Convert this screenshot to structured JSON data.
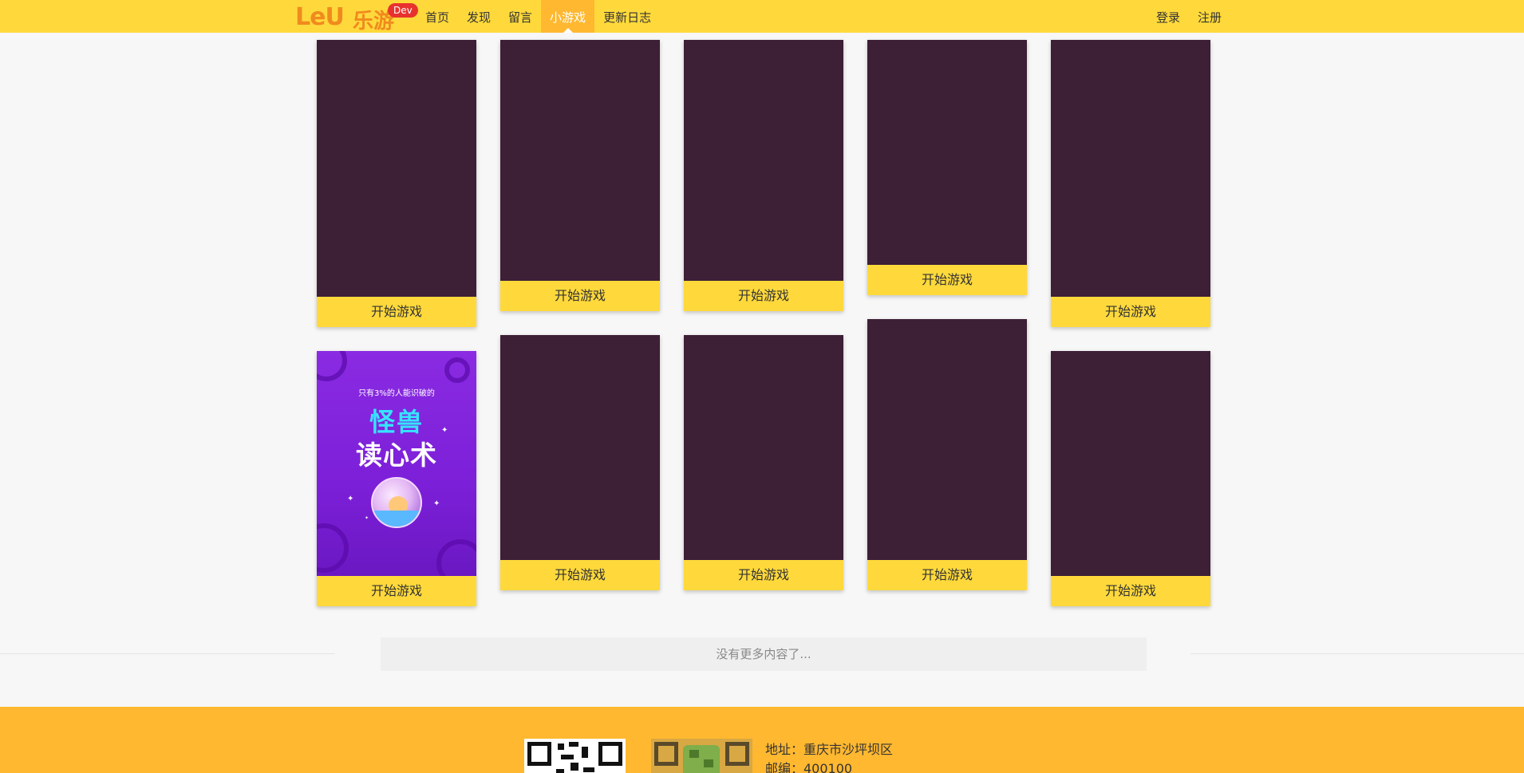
{
  "header": {
    "logo_text": "LeU",
    "logo_cn": "乐游",
    "badge": "Dev",
    "nav": [
      {
        "label": "首页",
        "active": false
      },
      {
        "label": "发现",
        "active": false
      },
      {
        "label": "留言",
        "active": false
      },
      {
        "label": "小游戏",
        "active": true
      },
      {
        "label": "更新日志",
        "active": false
      }
    ],
    "auth": {
      "login": "登录",
      "register": "注册"
    }
  },
  "games": {
    "start_label": "开始游戏",
    "featured_cover": {
      "tagline": "只有3%的人能识破的",
      "title_line1": "怪兽",
      "title_line2": "读心术"
    }
  },
  "list_end": "没有更多内容了...",
  "footer": {
    "address": "地址：重庆市沙坪坝区",
    "postcode": "邮编：400100"
  },
  "colors": {
    "brand_yellow": "#ffd93b",
    "accent_orange": "#ffb830",
    "cover_dark": "#3d1f36"
  }
}
